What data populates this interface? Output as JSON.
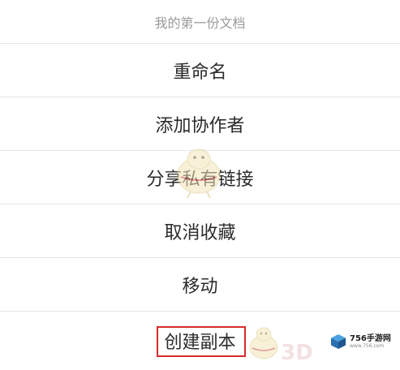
{
  "sheet": {
    "title": "我的第一份文档",
    "items": [
      {
        "label": "重命名"
      },
      {
        "label": "添加协作者"
      },
      {
        "label": "分享私有链接"
      },
      {
        "label": "取消收藏"
      },
      {
        "label": "移动"
      },
      {
        "label": "创建副本"
      }
    ]
  },
  "watermark": {
    "brand": "756手游网",
    "brand_sub": "www.756.com",
    "text_3d": "3D"
  },
  "colors": {
    "highlight": "#d42c2c",
    "divider": "#e6e6e6",
    "title_text": "#9a9a9a",
    "item_text": "#2b2b2b"
  }
}
